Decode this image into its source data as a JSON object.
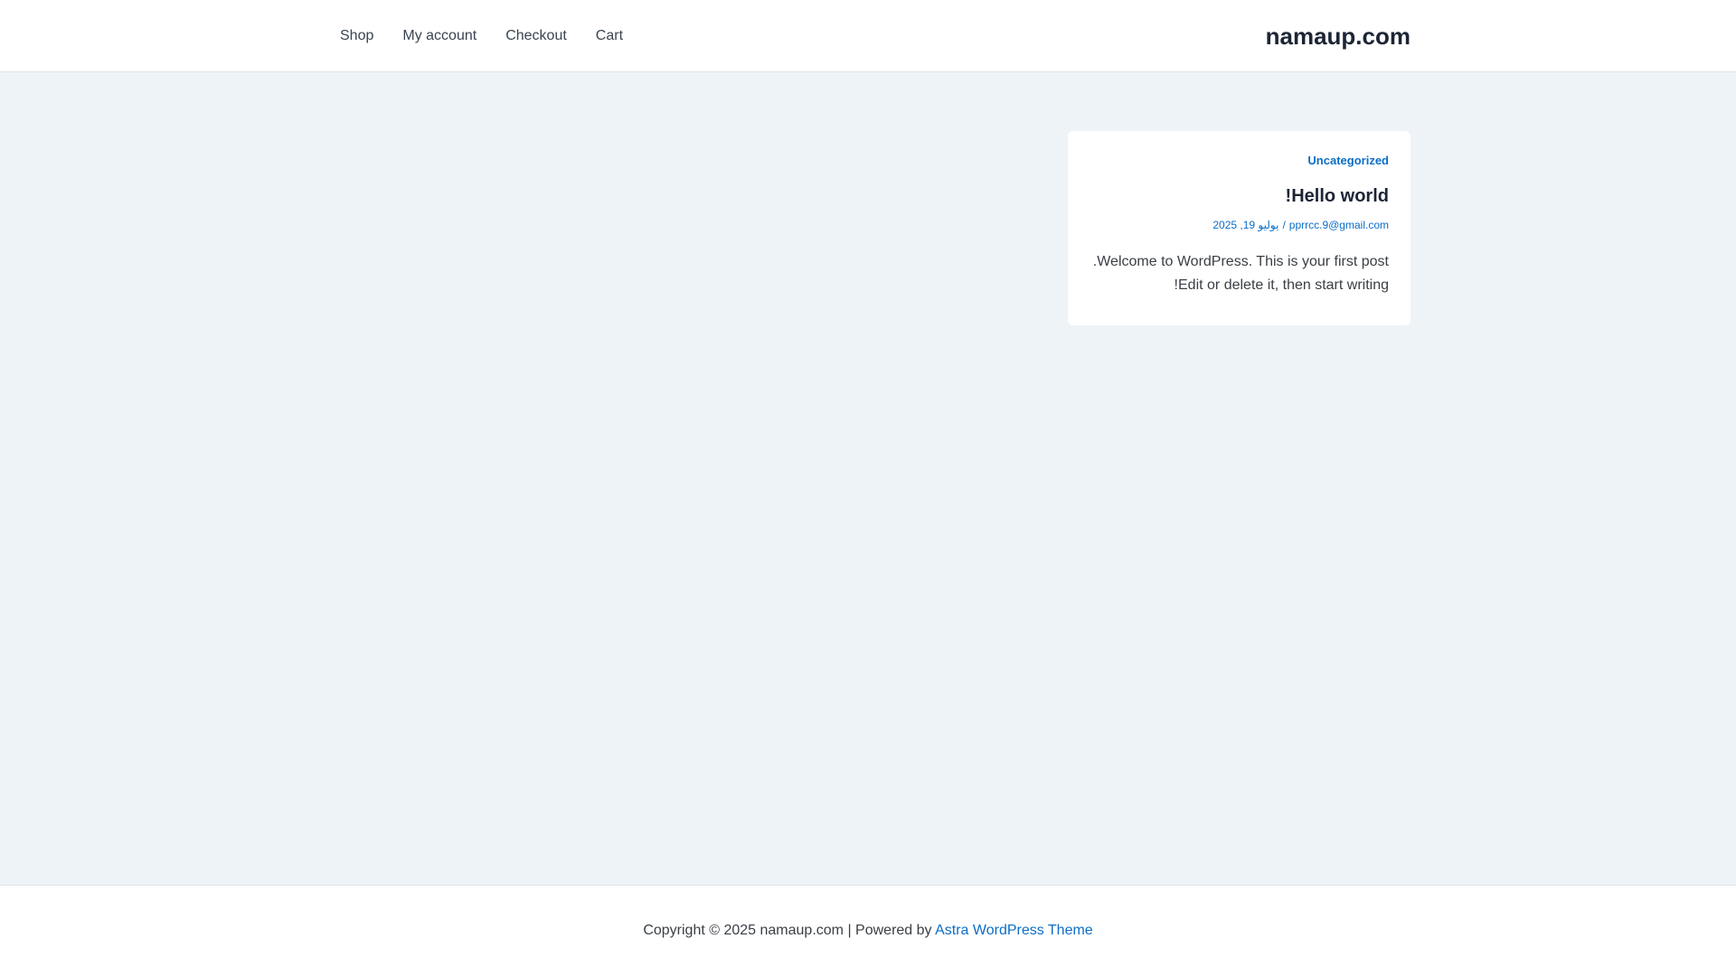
{
  "header": {
    "site_title": "namaup.com",
    "nav": [
      {
        "label": "Shop"
      },
      {
        "label": "My account"
      },
      {
        "label": "Checkout"
      },
      {
        "label": "Cart"
      }
    ]
  },
  "post": {
    "category": "Uncategorized",
    "title": "Hello world!",
    "meta_author": "pprrcc.9@gmail.com",
    "meta_separator": "/",
    "meta_date": "يوليو 19, 2025",
    "excerpt_line1": "Welcome to WordPress. This is your first post.",
    "excerpt_line2": "Edit or delete it, then start writing!"
  },
  "footer": {
    "copyright": "Copyright © 2025 namaup.com | Powered by ",
    "theme_link": "Astra WordPress Theme"
  },
  "colors": {
    "accent": "#0b6ec7",
    "background": "#eef3f8",
    "heading": "#1c2535"
  }
}
